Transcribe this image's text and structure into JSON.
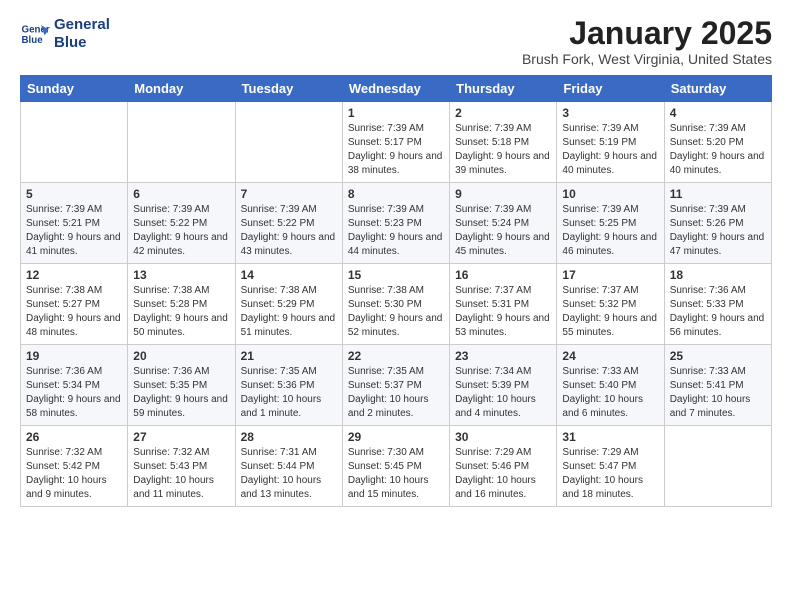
{
  "logo": {
    "line1": "General",
    "line2": "Blue"
  },
  "title": "January 2025",
  "subtitle": "Brush Fork, West Virginia, United States",
  "weekdays": [
    "Sunday",
    "Monday",
    "Tuesday",
    "Wednesday",
    "Thursday",
    "Friday",
    "Saturday"
  ],
  "weeks": [
    [
      {
        "day": "",
        "info": ""
      },
      {
        "day": "",
        "info": ""
      },
      {
        "day": "",
        "info": ""
      },
      {
        "day": "1",
        "info": "Sunrise: 7:39 AM\nSunset: 5:17 PM\nDaylight: 9 hours\nand 38 minutes."
      },
      {
        "day": "2",
        "info": "Sunrise: 7:39 AM\nSunset: 5:18 PM\nDaylight: 9 hours\nand 39 minutes."
      },
      {
        "day": "3",
        "info": "Sunrise: 7:39 AM\nSunset: 5:19 PM\nDaylight: 9 hours\nand 40 minutes."
      },
      {
        "day": "4",
        "info": "Sunrise: 7:39 AM\nSunset: 5:20 PM\nDaylight: 9 hours\nand 40 minutes."
      }
    ],
    [
      {
        "day": "5",
        "info": "Sunrise: 7:39 AM\nSunset: 5:21 PM\nDaylight: 9 hours\nand 41 minutes."
      },
      {
        "day": "6",
        "info": "Sunrise: 7:39 AM\nSunset: 5:22 PM\nDaylight: 9 hours\nand 42 minutes."
      },
      {
        "day": "7",
        "info": "Sunrise: 7:39 AM\nSunset: 5:22 PM\nDaylight: 9 hours\nand 43 minutes."
      },
      {
        "day": "8",
        "info": "Sunrise: 7:39 AM\nSunset: 5:23 PM\nDaylight: 9 hours\nand 44 minutes."
      },
      {
        "day": "9",
        "info": "Sunrise: 7:39 AM\nSunset: 5:24 PM\nDaylight: 9 hours\nand 45 minutes."
      },
      {
        "day": "10",
        "info": "Sunrise: 7:39 AM\nSunset: 5:25 PM\nDaylight: 9 hours\nand 46 minutes."
      },
      {
        "day": "11",
        "info": "Sunrise: 7:39 AM\nSunset: 5:26 PM\nDaylight: 9 hours\nand 47 minutes."
      }
    ],
    [
      {
        "day": "12",
        "info": "Sunrise: 7:38 AM\nSunset: 5:27 PM\nDaylight: 9 hours\nand 48 minutes."
      },
      {
        "day": "13",
        "info": "Sunrise: 7:38 AM\nSunset: 5:28 PM\nDaylight: 9 hours\nand 50 minutes."
      },
      {
        "day": "14",
        "info": "Sunrise: 7:38 AM\nSunset: 5:29 PM\nDaylight: 9 hours\nand 51 minutes."
      },
      {
        "day": "15",
        "info": "Sunrise: 7:38 AM\nSunset: 5:30 PM\nDaylight: 9 hours\nand 52 minutes."
      },
      {
        "day": "16",
        "info": "Sunrise: 7:37 AM\nSunset: 5:31 PM\nDaylight: 9 hours\nand 53 minutes."
      },
      {
        "day": "17",
        "info": "Sunrise: 7:37 AM\nSunset: 5:32 PM\nDaylight: 9 hours\nand 55 minutes."
      },
      {
        "day": "18",
        "info": "Sunrise: 7:36 AM\nSunset: 5:33 PM\nDaylight: 9 hours\nand 56 minutes."
      }
    ],
    [
      {
        "day": "19",
        "info": "Sunrise: 7:36 AM\nSunset: 5:34 PM\nDaylight: 9 hours\nand 58 minutes."
      },
      {
        "day": "20",
        "info": "Sunrise: 7:36 AM\nSunset: 5:35 PM\nDaylight: 9 hours\nand 59 minutes."
      },
      {
        "day": "21",
        "info": "Sunrise: 7:35 AM\nSunset: 5:36 PM\nDaylight: 10 hours\nand 1 minute."
      },
      {
        "day": "22",
        "info": "Sunrise: 7:35 AM\nSunset: 5:37 PM\nDaylight: 10 hours\nand 2 minutes."
      },
      {
        "day": "23",
        "info": "Sunrise: 7:34 AM\nSunset: 5:39 PM\nDaylight: 10 hours\nand 4 minutes."
      },
      {
        "day": "24",
        "info": "Sunrise: 7:33 AM\nSunset: 5:40 PM\nDaylight: 10 hours\nand 6 minutes."
      },
      {
        "day": "25",
        "info": "Sunrise: 7:33 AM\nSunset: 5:41 PM\nDaylight: 10 hours\nand 7 minutes."
      }
    ],
    [
      {
        "day": "26",
        "info": "Sunrise: 7:32 AM\nSunset: 5:42 PM\nDaylight: 10 hours\nand 9 minutes."
      },
      {
        "day": "27",
        "info": "Sunrise: 7:32 AM\nSunset: 5:43 PM\nDaylight: 10 hours\nand 11 minutes."
      },
      {
        "day": "28",
        "info": "Sunrise: 7:31 AM\nSunset: 5:44 PM\nDaylight: 10 hours\nand 13 minutes."
      },
      {
        "day": "29",
        "info": "Sunrise: 7:30 AM\nSunset: 5:45 PM\nDaylight: 10 hours\nand 15 minutes."
      },
      {
        "day": "30",
        "info": "Sunrise: 7:29 AM\nSunset: 5:46 PM\nDaylight: 10 hours\nand 16 minutes."
      },
      {
        "day": "31",
        "info": "Sunrise: 7:29 AM\nSunset: 5:47 PM\nDaylight: 10 hours\nand 18 minutes."
      },
      {
        "day": "",
        "info": ""
      }
    ]
  ]
}
